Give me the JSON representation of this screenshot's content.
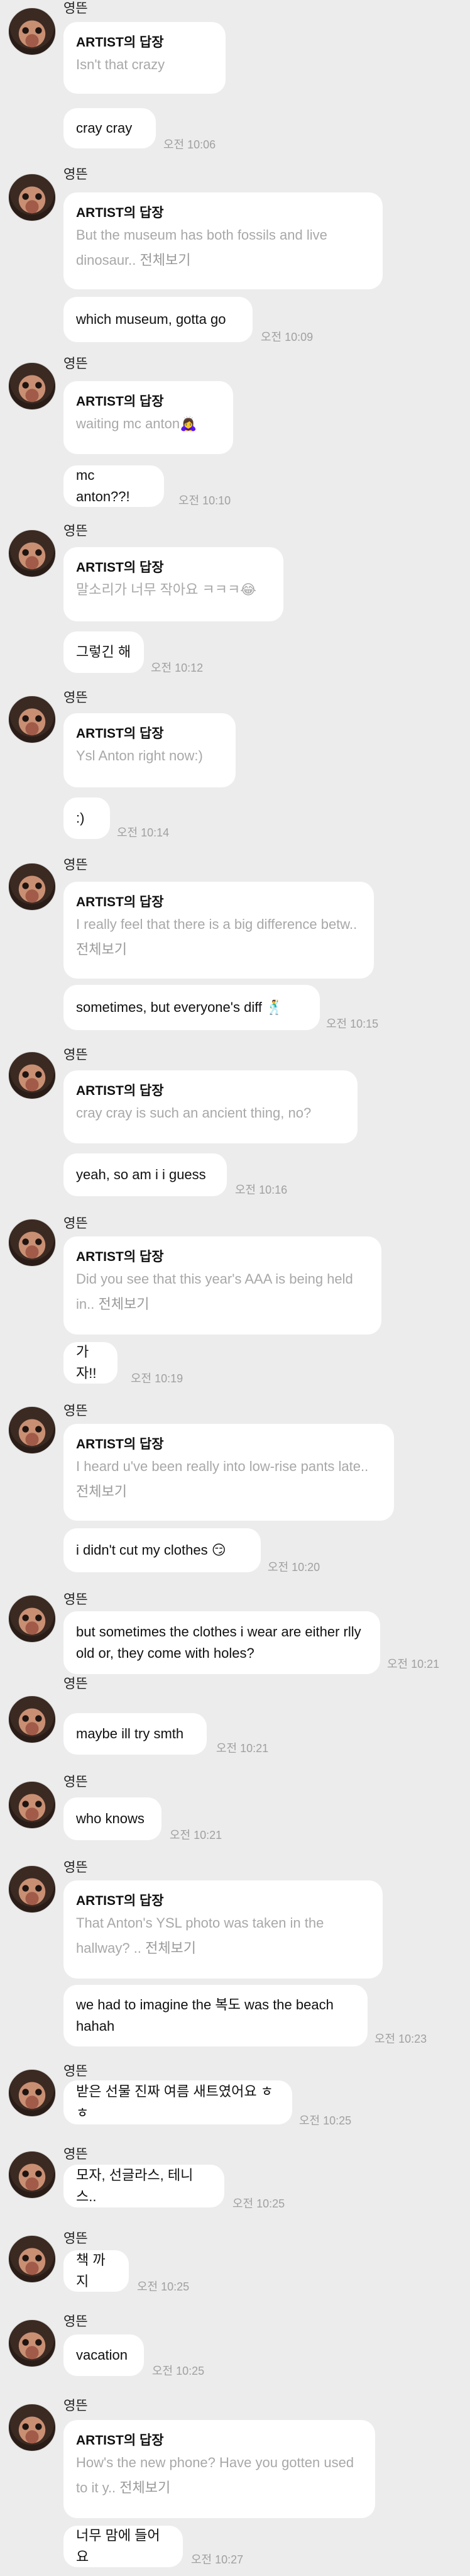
{
  "sender_name": "영뜬",
  "reply_header": "ARTIST의 답장",
  "more_label": "전체보기",
  "groups": [
    {
      "reply": "Isn't that crazy",
      "messages": [
        {
          "text": "cray cray",
          "time": "오전 10:06"
        }
      ]
    },
    {
      "reply": "But the museum has both fossils and live dinosaur..",
      "reply_more": true,
      "messages": [
        {
          "text": "which museum, gotta go",
          "time": "오전 10:09"
        }
      ]
    },
    {
      "reply": "waiting mc anton🙇‍♀️",
      "messages": [
        {
          "text": "mc anton??!",
          "time": "오전 10:10"
        }
      ]
    },
    {
      "reply": "말소리가 너무 작아요 ㅋㅋㅋ😂",
      "messages": [
        {
          "text": "그렇긴 해",
          "time": "오전 10:12"
        }
      ]
    },
    {
      "reply": "Ysl Anton right now:)",
      "messages": [
        {
          "text": ":)",
          "time": "오전 10:14"
        }
      ]
    },
    {
      "reply": "I really feel that there is a big difference betw..",
      "reply_more": true,
      "messages": [
        {
          "text": "sometimes, but everyone's diff 🕺",
          "time": "오전 10:15"
        }
      ]
    },
    {
      "reply": "cray cray is such an ancient thing, no?",
      "messages": [
        {
          "text": "yeah, so am i i guess",
          "time": "오전 10:16"
        }
      ]
    },
    {
      "reply": "Did you see that this year's AAA is being held in..",
      "reply_more": true,
      "messages": [
        {
          "text": "가자!!",
          "time": "오전 10:19"
        }
      ]
    },
    {
      "reply": "I heard u've been really into low-rise pants late..",
      "reply_more": true,
      "messages": [
        {
          "text": "i didn't cut my clothes 😏",
          "time": "오전 10:20"
        }
      ]
    },
    {
      "messages": [
        {
          "text": "but sometimes the clothes i wear are either rlly old or, they come with holes?",
          "time": "오전 10:21"
        }
      ]
    },
    {
      "messages": [
        {
          "text": "maybe ill try smth",
          "time": "오전 10:21"
        }
      ]
    },
    {
      "messages": [
        {
          "text": "who knows",
          "time": "오전 10:21"
        }
      ]
    },
    {
      "reply": "That Anton's YSL photo was taken in the hallway? ..",
      "reply_more": true,
      "messages": [
        {
          "text": "we had to imagine the 복도 was the beach hahah",
          "time": "오전 10:23"
        }
      ]
    },
    {
      "messages": [
        {
          "text": "받은 선물 진짜 여름 새트였어요 ㅎㅎ",
          "time": "오전 10:25"
        }
      ]
    },
    {
      "messages": [
        {
          "text": "모자, 선글라스, 테니스..",
          "time": "오전 10:25"
        }
      ]
    },
    {
      "messages": [
        {
          "text": "책 까지",
          "time": "오전 10:25"
        }
      ]
    },
    {
      "messages": [
        {
          "text": "vacation",
          "time": "오전 10:25"
        }
      ]
    },
    {
      "reply": "How's the new phone? Have you gotten used to it y..",
      "reply_more": true,
      "messages": [
        {
          "text": "너무 맘에 들어요",
          "time": "오전 10:27"
        }
      ]
    }
  ]
}
